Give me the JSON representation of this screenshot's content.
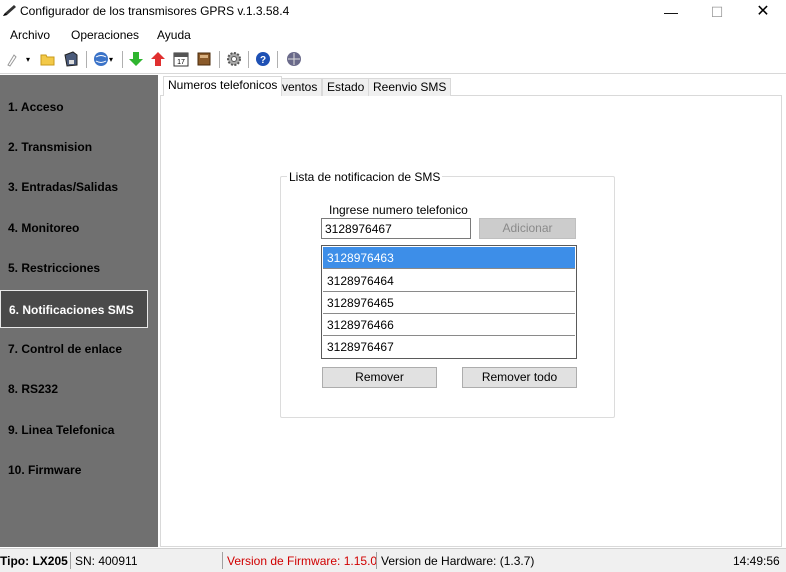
{
  "window": {
    "title": "Configurador de los transmisores GPRS v.1.3.58.4",
    "minimize": "—",
    "maximize": "☐",
    "close": "✕"
  },
  "menu": [
    "Archivo",
    "Operaciones",
    "Ayuda"
  ],
  "toolbar": {
    "icons": [
      "new-icon",
      "open-folder-icon",
      "save-icon",
      "connect-globe-icon",
      "download-arrow-icon",
      "upload-arrow-icon",
      "calendar-icon",
      "book-icon",
      "settings-gear-icon",
      "help-icon",
      "network-icon"
    ]
  },
  "sidebar": {
    "items": [
      {
        "label": "1. Acceso"
      },
      {
        "label": "2. Transmision"
      },
      {
        "label": "3. Entradas/Salidas"
      },
      {
        "label": "4. Monitoreo"
      },
      {
        "label": "5. Restricciones"
      },
      {
        "label": "6. Notificaciones SMS"
      },
      {
        "label": "7. Control de enlace"
      },
      {
        "label": "8. RS232"
      },
      {
        "label": "9. Linea Telefonica"
      },
      {
        "label": "10. Firmware"
      }
    ],
    "active_index": 5
  },
  "tabs": [
    {
      "label": "Numeros telefonicos"
    },
    {
      "label": "Eventos"
    },
    {
      "label": "Estado"
    },
    {
      "label": "Reenvio SMS"
    }
  ],
  "sms_group": {
    "legend": "Lista de notificacion de SMS",
    "input_label": "Ingrese numero telefonico",
    "input_value": "3128976467",
    "add_button": "Adicionar",
    "numbers": [
      "3128976463",
      "3128976464",
      "3128976465",
      "3128976466",
      "3128976467"
    ],
    "selected_index": 0,
    "remove_button": "Remover",
    "remove_all_button": "Remover todo"
  },
  "status": {
    "tipo": "Tipo: LX205",
    "sn": "SN: 400911",
    "firmware": "Version de Firmware: 1.15.0",
    "hardware": "Version de Hardware: (1.3.7)",
    "time": "14:49:56",
    "firmware_color": "#d00000"
  }
}
